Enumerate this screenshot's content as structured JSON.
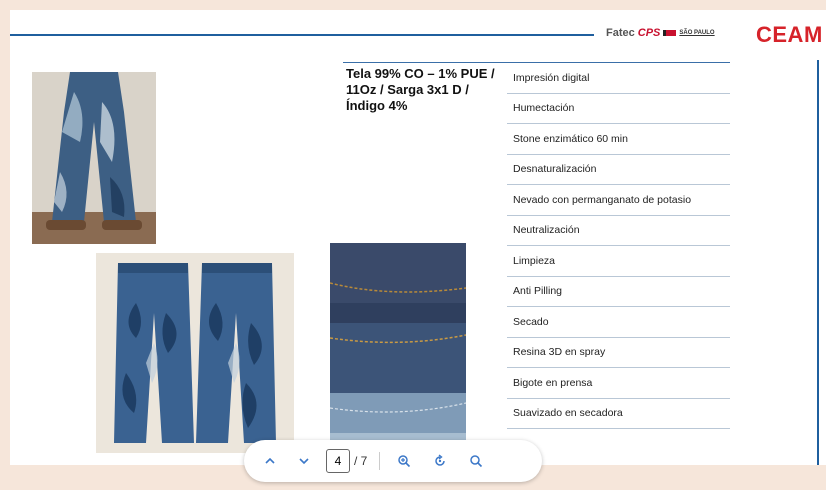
{
  "header": {
    "logo_fatec": "Fatec",
    "logo_cps": "CPS",
    "logo_sp": "SÃO PAULO",
    "logo_ceam": "CEAM",
    "brand_blue": "#1f5f9e",
    "brand_red": "#d6232a"
  },
  "fabric_spec": "Tela 99% CO – 1% PUE / 11Oz / Sarga 3x1 D / Índigo 4%",
  "processes": [
    "Impresión digital",
    "Humectación",
    "Stone enzimático 60 min",
    "Desnaturalización",
    "Nevado con permanganato de potasio",
    "Neutralización",
    "Limpieza",
    "Anti Pilling",
    "Secado",
    "Resina 3D en spray",
    "Bigote en prensa",
    "Suavizado en secadora"
  ],
  "toolbar": {
    "current_page": "4",
    "total_pages": "/ 7",
    "icons": [
      "chevron-up-icon",
      "chevron-down-icon",
      "zoom-in-icon",
      "rotate-icon",
      "search-icon"
    ]
  }
}
